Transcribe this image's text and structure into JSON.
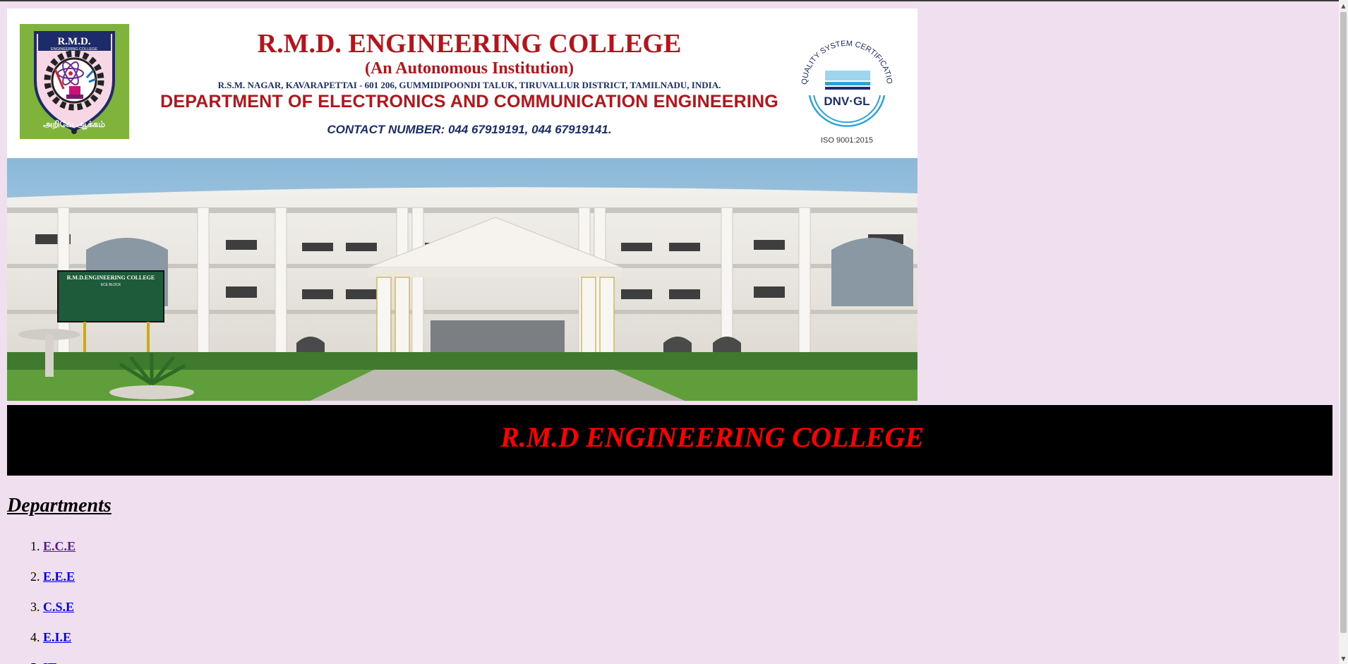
{
  "banner": {
    "logo_text": "R.M.D.",
    "logo_sub": "ENGINEERING COLLEGE",
    "logo_motto": "அறிவே ஆக்கம்",
    "college_name": "R.M.D. ENGINEERING COLLEGE",
    "autonomous": "(An Autonomous Institution)",
    "address": "R.S.M. NAGAR, KAVARAPETTAI - 601 206, GUMMIDIPOONDI TALUK, TIRUVALLUR DISTRICT, TAMILNADU, INDIA.",
    "department": "DEPARTMENT OF ELECTRONICS AND COMMUNICATION ENGINEERING",
    "contact": "CONTACT NUMBER: 044 67919191, 044 67919141.",
    "cert_arc_text": "QUALITY SYSTEM CERTIFICATION",
    "cert_brand": "DNV·GL",
    "cert_iso": "ISO 9001:2015"
  },
  "photo": {
    "board_title": "R.M.D.ENGINEERING COLLEGE",
    "board_sub": "ECE BLOCK"
  },
  "title_bar": {
    "text": "R.M.D ENGINEERING COLLEGE",
    "text_color": "#ff0000",
    "background": "#000000"
  },
  "departments": {
    "heading": "Departments",
    "items": [
      {
        "label": "E.C.E",
        "visited": true
      },
      {
        "label": "E.E.E",
        "visited": false
      },
      {
        "label": "C.S.E",
        "visited": false
      },
      {
        "label": "E.I.E",
        "visited": false
      },
      {
        "label": "IT",
        "visited": false
      }
    ]
  },
  "colors": {
    "page_background": "#efdfef",
    "link": "#0000ee",
    "visited_link": "#551a8b",
    "banner_red": "#b4141a",
    "banner_navy": "#1b2e6b"
  }
}
